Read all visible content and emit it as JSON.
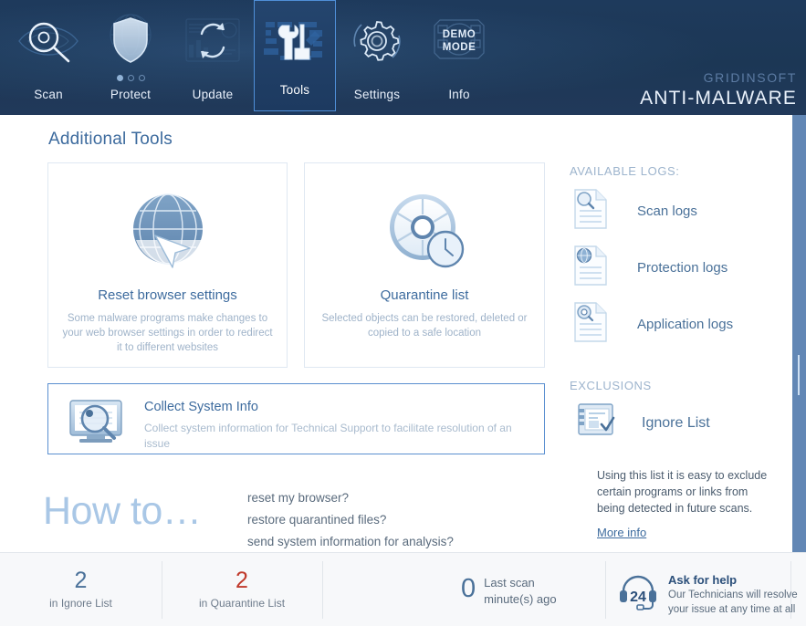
{
  "header": {
    "nav": [
      {
        "id": "scan",
        "label": "Scan",
        "icon": "magnifier-eye-icon",
        "active": false
      },
      {
        "id": "protect",
        "label": "Protect",
        "icon": "shield-globe-icon",
        "active": false
      },
      {
        "id": "update",
        "label": "Update",
        "icon": "refresh-arrows-icon",
        "active": false
      },
      {
        "id": "tools",
        "label": "Tools",
        "icon": "wrench-screwdriver-icon",
        "active": true
      },
      {
        "id": "settings",
        "label": "Settings",
        "icon": "gear-icon",
        "active": false
      },
      {
        "id": "info",
        "label": "Info",
        "icon": "demo-mode-icon",
        "active": false
      }
    ],
    "demo_badge": {
      "line1": "DEMO",
      "line2": "MODE"
    },
    "brand_top": "GRIDINSOFT",
    "brand_bottom": "ANTI-MALWARE"
  },
  "main": {
    "title": "Additional Tools",
    "cards": [
      {
        "id": "reset-browser-settings",
        "icon": "globe-cursor-icon",
        "title": "Reset browser settings",
        "desc": "Some malware programs make changes to your web browser settings in order to redirect it to different websites"
      },
      {
        "id": "quarantine-list",
        "icon": "disc-clock-icon",
        "title": "Quarantine list",
        "desc": "Selected objects can be restored, deleted or copied to a safe location"
      }
    ],
    "collect": {
      "icon": "monitor-magnifier-icon",
      "title": "Collect System Info",
      "desc": "Collect system information for Technical Support to facilitate resolution of an issue"
    },
    "howto": {
      "title": "How to…",
      "questions": [
        "reset my browser?",
        "restore quarantined files?",
        "send system information for analysis?"
      ]
    }
  },
  "right": {
    "logs_heading": "AVAILABLE LOGS:",
    "logs": [
      {
        "id": "scan-logs",
        "label": "Scan logs",
        "icon": "document-magnifier-icon"
      },
      {
        "id": "protection-logs",
        "label": "Protection logs",
        "icon": "document-globe-icon"
      },
      {
        "id": "application-logs",
        "label": "Application logs",
        "icon": "document-gear-icon"
      }
    ],
    "exclusions_heading": "EXCLUSIONS",
    "ignore_list": {
      "label": "Ignore List",
      "icon": "list-check-icon"
    },
    "exclusions_desc": "Using this list it is easy to exclude certain programs or links from being detected in future scans.",
    "more_info": "More info"
  },
  "footer": {
    "ignore": {
      "value": "2",
      "caption": "in Ignore List",
      "color": "#4a7199"
    },
    "quarantine": {
      "value": "2",
      "caption": "in Quarantine List",
      "color": "#c0392b"
    },
    "lastscan": {
      "value": "0",
      "line1": "Last scan",
      "line2": "minute(s) ago"
    },
    "help": {
      "icon": "headset-24-icon",
      "badge": "24",
      "title": "Ask for help",
      "sub1": "Our Technicians will resolve",
      "sub2": "your issue at any time at all"
    }
  },
  "colors": {
    "header_bg": "#1e3a5c",
    "accent": "#4f8fd8",
    "link": "#3d6b9e",
    "muted": "#9fb3c9",
    "danger": "#c0392b",
    "scrollbar": "#6287b5"
  }
}
